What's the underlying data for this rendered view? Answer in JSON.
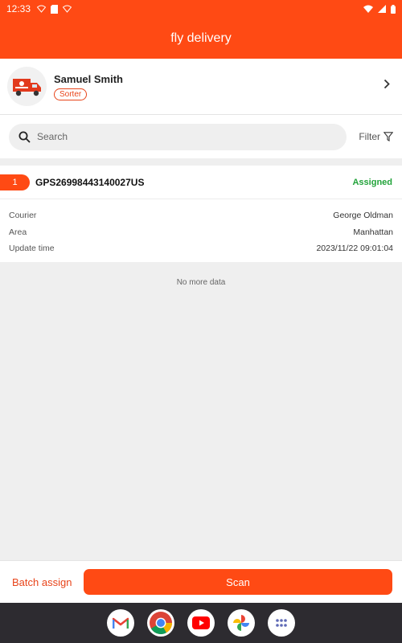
{
  "status_bar": {
    "time": "12:33"
  },
  "app_bar": {
    "title": "fly delivery"
  },
  "profile": {
    "name": "Samuel Smith",
    "role": "Sorter"
  },
  "search": {
    "placeholder": "Search",
    "filter_label": "Filter"
  },
  "card": {
    "index": "1",
    "tracking": "GPS26998443140027US",
    "status": "Assigned",
    "rows": [
      {
        "label": "Courier",
        "value": "George Oldman"
      },
      {
        "label": "Area",
        "value": "Manhattan"
      },
      {
        "label": "Update time",
        "value": "2023/11/22 09:01:04"
      }
    ]
  },
  "list_footer": "No more data",
  "bottom": {
    "batch_label": "Batch assign",
    "scan_label": "Scan"
  },
  "dock_apps": [
    "gmail-icon",
    "chrome-icon",
    "youtube-icon",
    "photos-icon",
    "app-drawer-icon"
  ],
  "colors": {
    "brand": "#ff4a14",
    "assigned": "#22a33a"
  }
}
